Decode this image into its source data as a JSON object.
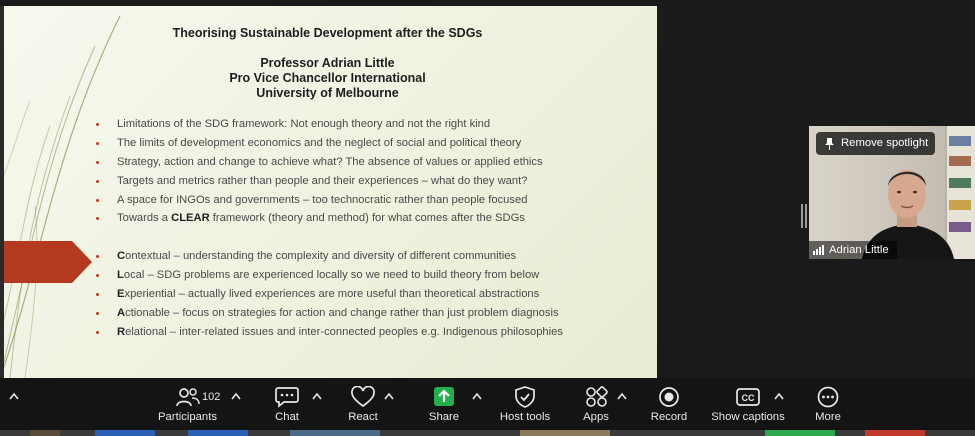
{
  "slide": {
    "title": "Theorising Sustainable Development after the SDGs",
    "presenter_name": "Professor Adrian Little",
    "presenter_role": "Pro Vice Chancellor International",
    "presenter_org": "University of Melbourne",
    "bullets_a": [
      {
        "text": "Limitations of the SDG framework: Not enough theory and not the right kind"
      },
      {
        "text": "The limits of development economics and the neglect of social and political theory"
      },
      {
        "text": "Strategy, action and change to achieve what? The absence of values or applied ethics"
      },
      {
        "text": "Targets and metrics rather than people and their experiences – what do they want?"
      },
      {
        "text": "A space for INGOs and governments – too technocratic rather than people focused"
      },
      {
        "pre": "Towards a ",
        "bold": "CLEAR",
        "post": " framework (theory and method) for what comes after the SDGs"
      }
    ],
    "bullets_b": [
      {
        "bold": "C",
        "post": "ontextual – understanding the complexity and diversity of different communities"
      },
      {
        "bold": "L",
        "post": "ocal – SDG problems are experienced locally so we need to build theory from below"
      },
      {
        "bold": "E",
        "post": "xperiential – actually lived experiences are more useful than theoretical abstractions"
      },
      {
        "bold": "A",
        "post": "ctionable – focus on strategies for action and change rather than just problem diagnosis"
      },
      {
        "bold": "R",
        "post": "elational – inter-related issues and inter-connected peoples e.g. Indigenous philosophies"
      }
    ],
    "accent_color": "#b33a1f",
    "bullet_color": "#c0392b"
  },
  "participant": {
    "spotlight_label": "Remove spotlight",
    "name": "Adrian Little"
  },
  "toolbar": {
    "participants_label": "Participants",
    "participants_count": "102",
    "chat_label": "Chat",
    "react_label": "React",
    "share_label": "Share",
    "host_tools_label": "Host tools",
    "apps_label": "Apps",
    "record_label": "Record",
    "captions_label": "Show captions",
    "more_label": "More",
    "share_color": "#21b04b"
  },
  "icons": [
    "chevron-up-icon",
    "participants-icon",
    "chat-icon",
    "react-icon",
    "share-icon",
    "shield-icon",
    "apps-icon",
    "record-icon",
    "captions-icon",
    "more-icon",
    "pin-icon",
    "signal-bars-icon"
  ]
}
